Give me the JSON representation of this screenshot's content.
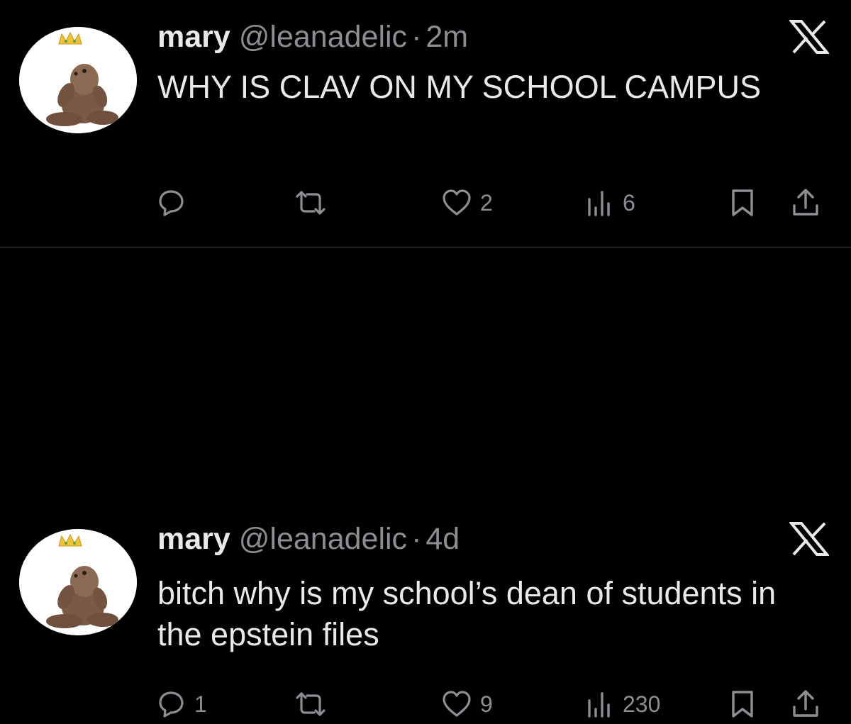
{
  "tweets": [
    {
      "name": "mary",
      "handle": "@leanadelic",
      "separator": "·",
      "time": "2m",
      "text": "WHY IS CLAV ON MY SCHOOL CAMPUS",
      "replies": "",
      "likes": "2",
      "views": "6"
    },
    {
      "name": "mary",
      "handle": "@leanadelic",
      "separator": "·",
      "time": "4d",
      "text": "bitch why is my school’s dean of students in the epstein files",
      "replies": "1",
      "likes": "9",
      "views": "230"
    }
  ],
  "icons": {
    "logo": "x-logo-icon",
    "reply": "reply-icon",
    "retweet": "retweet-icon",
    "like": "heart-icon",
    "views": "views-chart-icon",
    "bookmark": "bookmark-icon",
    "share": "share-icon"
  },
  "colors": {
    "background": "#000000",
    "text": "#e7e9ea",
    "muted": "#8b8f94",
    "divider": "#2f3336"
  }
}
